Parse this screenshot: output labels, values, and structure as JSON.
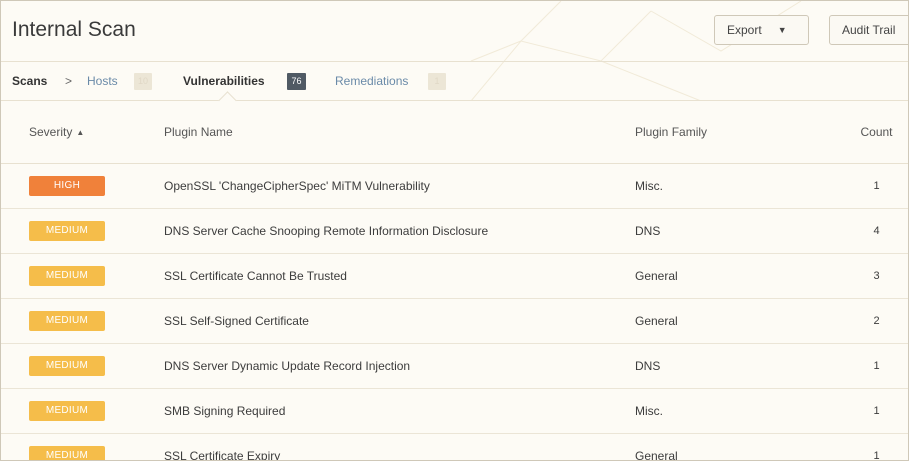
{
  "header": {
    "title": "Internal Scan",
    "export_label": "Export",
    "audit_label": "Audit Trail"
  },
  "breadcrumb": {
    "scans": "Scans",
    "separator": ">",
    "hosts": "Hosts",
    "hosts_count": "10",
    "vulnerabilities": "Vulnerabilities",
    "vulnerabilities_count": "76",
    "remediations": "Remediations",
    "remediations_count": "1"
  },
  "table": {
    "columns": {
      "severity": "Severity",
      "plugin_name": "Plugin Name",
      "plugin_family": "Plugin Family",
      "count": "Count"
    },
    "rows": [
      {
        "severity": "HIGH",
        "plugin_name": "OpenSSL 'ChangeCipherSpec' MiTM Vulnerability",
        "plugin_family": "Misc.",
        "count": "1"
      },
      {
        "severity": "MEDIUM",
        "plugin_name": "DNS Server Cache Snooping Remote Information Disclosure",
        "plugin_family": "DNS",
        "count": "4"
      },
      {
        "severity": "MEDIUM",
        "plugin_name": "SSL Certificate Cannot Be Trusted",
        "plugin_family": "General",
        "count": "3"
      },
      {
        "severity": "MEDIUM",
        "plugin_name": "SSL Self-Signed Certificate",
        "plugin_family": "General",
        "count": "2"
      },
      {
        "severity": "MEDIUM",
        "plugin_name": "DNS Server Dynamic Update Record Injection",
        "plugin_family": "DNS",
        "count": "1"
      },
      {
        "severity": "MEDIUM",
        "plugin_name": "SMB Signing Required",
        "plugin_family": "Misc.",
        "count": "1"
      },
      {
        "severity": "MEDIUM",
        "plugin_name": "SSL Certificate Expiry",
        "plugin_family": "General",
        "count": "1"
      }
    ]
  },
  "colors": {
    "high": "#f0813a",
    "medium": "#f5bd4a",
    "badge_dark": "#505a64",
    "link": "#6a8aa8"
  },
  "icons": {
    "sort": "caret-up-icon",
    "dropdown": "caret-down-icon"
  }
}
